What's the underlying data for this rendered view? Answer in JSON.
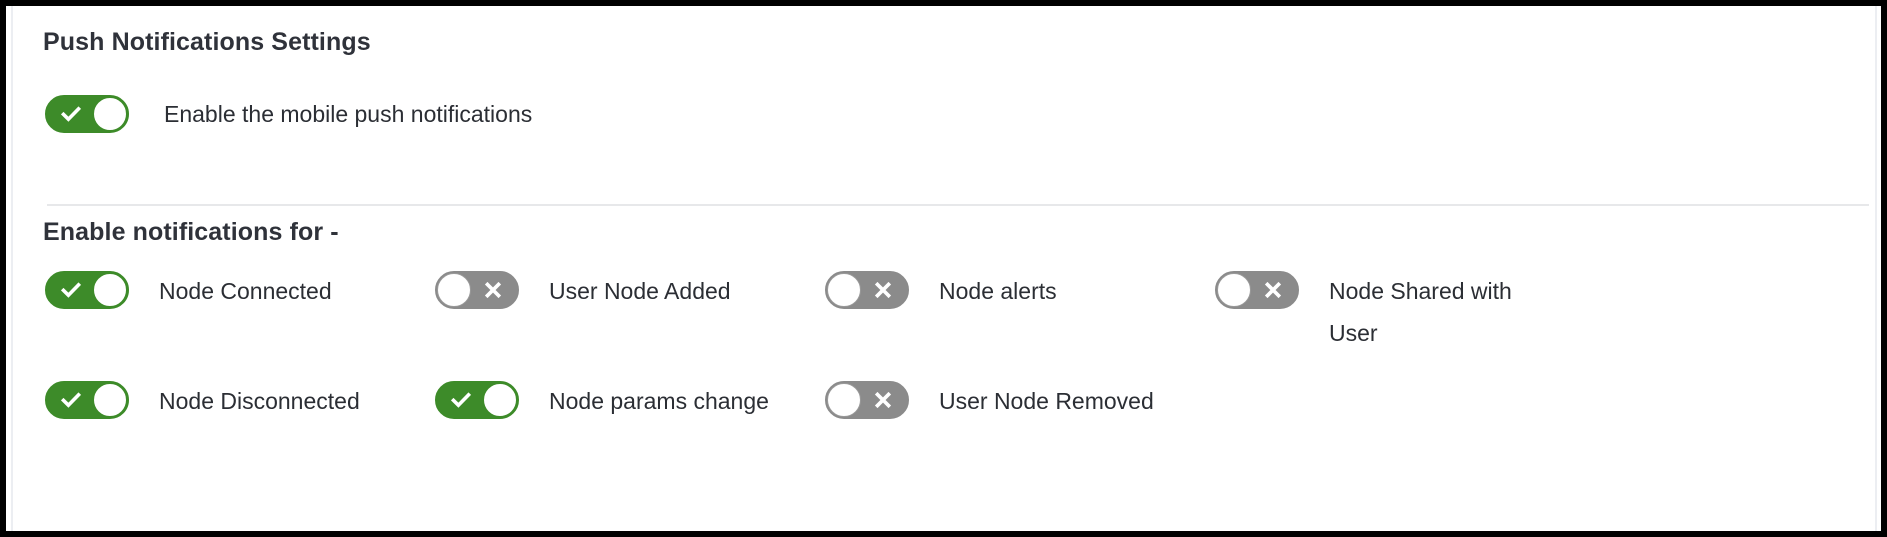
{
  "panel": {
    "push_section_title": "Push Notifications Settings",
    "enable_section_title": "Enable notifications for -",
    "colors": {
      "on_green": "#3d8b29",
      "off_gray": "#8b8b8b",
      "text": "#2b2e34",
      "divider": "#e7e8ea",
      "frame": "#000000"
    }
  },
  "push": {
    "toggle": {
      "label": "Enable the mobile push notifications",
      "state": "on",
      "glyph": "check-icon"
    }
  },
  "notifications": {
    "rows": [
      [
        {
          "label": "Node Connected",
          "state": "on",
          "glyph": "check-icon",
          "wrap": false
        },
        {
          "label": "User Node Added",
          "state": "off",
          "glyph": "close-icon",
          "wrap": false
        },
        {
          "label": "Node alerts",
          "state": "off",
          "glyph": "close-icon",
          "wrap": false
        },
        {
          "label": "Node Shared with User",
          "state": "off",
          "glyph": "close-icon",
          "wrap": true
        }
      ],
      [
        {
          "label": "Node Disconnected",
          "state": "on",
          "glyph": "check-icon",
          "wrap": false
        },
        {
          "label": "Node params change",
          "state": "on",
          "glyph": "check-icon",
          "wrap": false
        },
        {
          "label": "User Node Removed",
          "state": "off",
          "glyph": "close-icon",
          "wrap": false
        }
      ]
    ]
  }
}
